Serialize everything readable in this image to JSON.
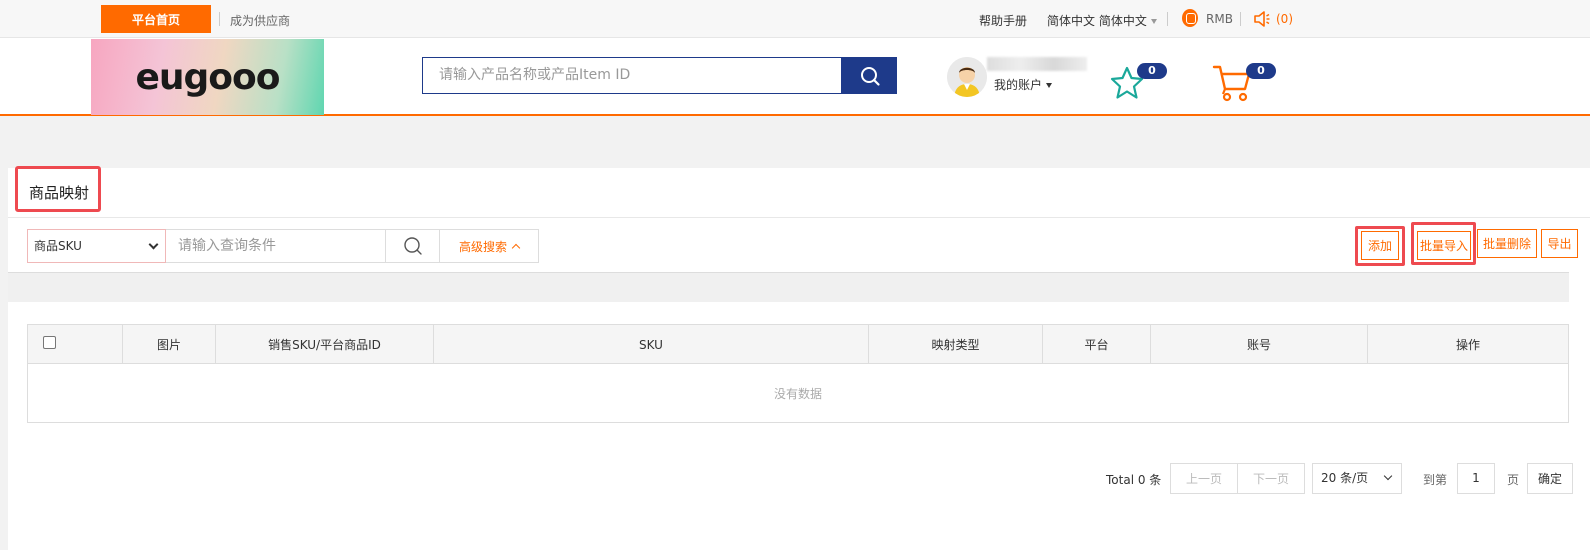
{
  "topbar": {
    "home_label": "平台首页",
    "supplier_label": "成为供应商",
    "help_label": "帮助手册",
    "language_label": "简体中文 简体中文",
    "currency_label": "RMB",
    "notify_count": "(0)"
  },
  "header": {
    "logo_text": "eugooo",
    "search_placeholder": "请输入产品名称或产品Item ID",
    "account_label": "我的账户",
    "favorites_count": "0",
    "cart_count": "0"
  },
  "page": {
    "title": "商品映射"
  },
  "filter": {
    "field_select": "商品SKU",
    "query_placeholder": "请输入查询条件",
    "advanced_label": "高级搜索"
  },
  "actions": {
    "add": "添加",
    "batch_import": "批量导入",
    "batch_delete": "批量删除",
    "export": "导出"
  },
  "table": {
    "columns": [
      "图片",
      "销售SKU/平台商品ID",
      "SKU",
      "映射类型",
      "平台",
      "账号",
      "操作"
    ],
    "empty_text": "没有数据"
  },
  "pagination": {
    "total": "Total 0 条",
    "prev": "上一页",
    "next": "下一页",
    "page_size": "20 条/页",
    "goto_label": "到第",
    "page_value": "1",
    "page_suffix": "页",
    "confirm": "确定"
  },
  "colors": {
    "accent": "#ff6a00",
    "brand_blue": "#1e3a8a",
    "highlight_red": "#ee4a50"
  }
}
